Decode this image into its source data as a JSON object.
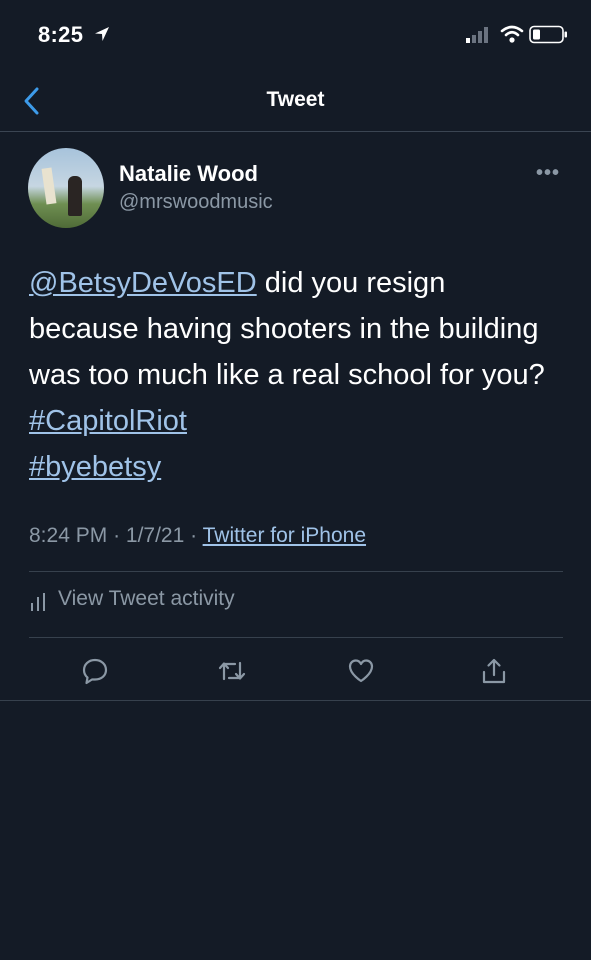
{
  "status_bar": {
    "time": "8:25"
  },
  "nav": {
    "title": "Tweet"
  },
  "author": {
    "name": "Natalie Wood",
    "handle": "@mrswoodmusic"
  },
  "tweet": {
    "mention": "@BetsyDeVosED",
    "text": " did you resign because having shooters in the building was too much like a real school for you? ",
    "hashtag_1": "#CapitolRiot",
    "hashtag_2": "#byebetsy"
  },
  "meta": {
    "time": "8:24 PM",
    "separator": "·",
    "date": "1/7/21",
    "source": "Twitter for iPhone"
  },
  "activity_label": "View Tweet activity",
  "icons": {
    "reply": "reply-icon",
    "retweet": "retweet-icon",
    "like": "heart-icon",
    "share": "share-icon"
  },
  "colors": {
    "background": "#141b26",
    "link": "#a0c3e8",
    "secondary_text": "#8b98a5"
  }
}
